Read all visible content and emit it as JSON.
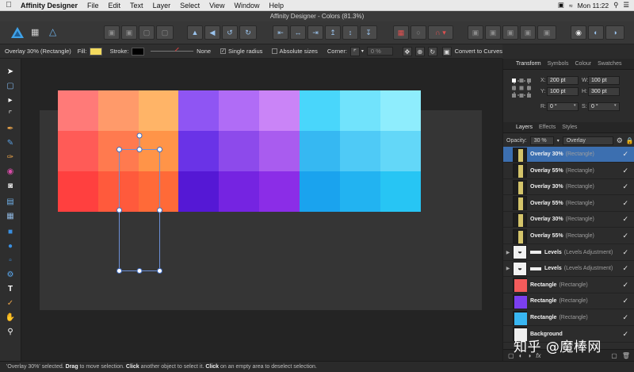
{
  "menubar": {
    "app_name": "Affinity Designer",
    "items": [
      "File",
      "Edit",
      "Text",
      "Layer",
      "Select",
      "View",
      "Window",
      "Help"
    ],
    "clock": "Mon 11:22"
  },
  "window": {
    "title": "Affinity Designer - Colors (81.3%)"
  },
  "context": {
    "selection_label": "Overlay 30% (Rectangle)",
    "fill_label": "Fill:",
    "fill_color": "#f3da5e",
    "stroke_label": "Stroke:",
    "stroke_color": "#000000",
    "stroke_value": "None",
    "single_radius": "Single radius",
    "absolute_sizes": "Absolute sizes",
    "corner_label": "Corner:",
    "corner_value": "0 %",
    "convert_label": "Convert to Curves"
  },
  "panel": {
    "top_tabs": [
      "Transform",
      "Symbols",
      "Colour",
      "Swatches"
    ],
    "transform": {
      "x_label": "X:",
      "x": "200 pt",
      "y_label": "Y:",
      "y": "100 pt",
      "w_label": "W:",
      "w": "100 pt",
      "h_label": "H:",
      "h": "300 pt",
      "r_label": "R:",
      "r": "0 °",
      "s_label": "S:",
      "s": "0 °"
    },
    "layer_tabs": [
      "Layers",
      "Effects",
      "Styles"
    ],
    "opacity_label": "Opacity:",
    "opacity_value": "30 %",
    "blend_mode": "Overlay",
    "layers": [
      {
        "name": "Overlay 30%",
        "kind": "(Rectangle)",
        "selected": true,
        "thumb": "#d4c46a",
        "type": "rect"
      },
      {
        "name": "Overlay 55%",
        "kind": "(Rectangle)",
        "selected": false,
        "thumb": "#d4c46a",
        "type": "rect"
      },
      {
        "name": "Overlay 30%",
        "kind": "(Rectangle)",
        "selected": false,
        "thumb": "#d4c46a",
        "type": "rect"
      },
      {
        "name": "Overlay 55%",
        "kind": "(Rectangle)",
        "selected": false,
        "thumb": "#d4c46a",
        "type": "rect"
      },
      {
        "name": "Overlay 30%",
        "kind": "(Rectangle)",
        "selected": false,
        "thumb": "#d4c46a",
        "type": "rect"
      },
      {
        "name": "Overlay 55%",
        "kind": "(Rectangle)",
        "selected": false,
        "thumb": "#d4c46a",
        "type": "rect"
      },
      {
        "name": "Levels",
        "kind": "(Levels Adjustment)",
        "selected": false,
        "thumb": "#f2f2f2",
        "type": "adj"
      },
      {
        "name": "Levels",
        "kind": "(Levels Adjustment)",
        "selected": false,
        "thumb": "#f2f2f2",
        "type": "adj"
      },
      {
        "name": "Rectangle",
        "kind": "(Rectangle)",
        "selected": false,
        "thumb": "#f35b5b",
        "type": "solid"
      },
      {
        "name": "Rectangle",
        "kind": "(Rectangle)",
        "selected": false,
        "thumb": "#7b3ff0",
        "type": "solid"
      },
      {
        "name": "Rectangle",
        "kind": "(Rectangle)",
        "selected": false,
        "thumb": "#38b6f2",
        "type": "solid"
      },
      {
        "name": "Background",
        "kind": "",
        "selected": false,
        "thumb": "#eeeeee",
        "type": "solid"
      }
    ]
  },
  "canvas": {
    "swatches": [
      [
        "#ff7a78",
        "#ff9a6a",
        "#ffb467",
        "#8f55f3",
        "#b06cf6",
        "#ca84f7",
        "#49d6fb",
        "#71e3fc",
        "#8eedfd"
      ],
      [
        "#ff5b57",
        "#ff7a4f",
        "#ff9448",
        "#6a33e7",
        "#8d4aeb",
        "#a95cef",
        "#36b8f2",
        "#4fcaf6",
        "#63d7f8"
      ],
      [
        "#ff403f",
        "#ff5a3c",
        "#ff6a38",
        "#5518d5",
        "#7524e1",
        "#8b2de7",
        "#1aa3ee",
        "#22b3f1",
        "#27c5f4"
      ]
    ]
  },
  "statusbar": {
    "part1": "'Overlay 30%' selected. ",
    "drag": "Drag",
    "part2": " to move selection. ",
    "click1": "Click",
    "part3": " another object to select it. ",
    "click2": "Click",
    "part4": " on an empty area to deselect selection."
  },
  "watermark": "知乎 @魔棒网"
}
